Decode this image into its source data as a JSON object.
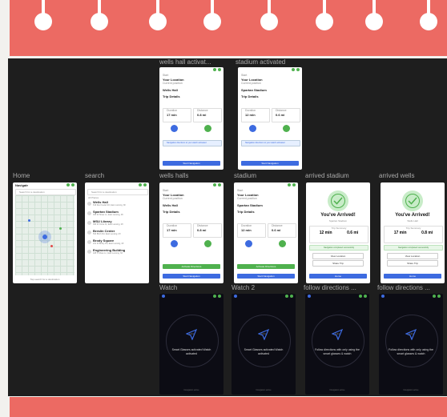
{
  "frames": {
    "wells_hall_activated": "wells hall activat...",
    "stadium_activated": "stadium activated",
    "home": "Home",
    "search": "search",
    "wells_halls": "wells halls",
    "stadium": "stadium",
    "arrived_stadium": "arrived stadium",
    "arrived_wells": "arrived wells",
    "watch": "Watch",
    "watch2": "Watch 2",
    "follow_directions_1": "follow directions ...",
    "follow_directions_2": "follow directions ..."
  },
  "home": {
    "title": "Navigatr",
    "search_placeholder": "Search for a destination",
    "hint": "Tap search for a destination"
  },
  "search": {
    "placeholder": "Search for a destination",
    "section": "All Places",
    "items": [
      {
        "name": "Wells Hall",
        "sub": "619 Red Cedar Rd, East Lansing, MI"
      },
      {
        "name": "Spartan Stadium",
        "sub": "325 W Shaw Ln, East Lansing, MI"
      },
      {
        "name": "MSU Library",
        "sub": "366 W Circle Dr, East Lansing, MI"
      },
      {
        "name": "Breslin Center",
        "sub": "534 Birch Rd, East Lansing, MI"
      },
      {
        "name": "Brody Square",
        "sub": "241 W Brody Rd, East Lansing, MI"
      },
      {
        "name": "Engineering Building",
        "sub": "428 S Shaw Ln, East Lansing, MI"
      }
    ]
  },
  "nav": {
    "your_location": "Your Location",
    "current_position": "Current position",
    "wells_hall": "Wells Hall",
    "spartan_stadium": "Spartan Stadium",
    "trip_details": "Trip Details",
    "duration_label": "Duration",
    "distance_label": "Distance",
    "wells_duration": "17 min",
    "wells_distance": "0.8 mi",
    "stadium_duration": "12 min",
    "stadium_distance": "0.6 mi",
    "walk": "Walk",
    "wheelchair": "Wheelchair",
    "activate": "Activate Directions",
    "start": "Start Navigation",
    "activated_note": "Navigation directions to your watch activated"
  },
  "arrived": {
    "title": "You've Arrived!",
    "stadium_name": "Spartan Stadium",
    "wells_name": "Wells Hall",
    "trip_summary": "Trip Summary",
    "stadium_time": "12 min",
    "stadium_dist": "0.6 mi",
    "wells_time": "17 min",
    "wells_dist": "0.8 mi",
    "completed": "Navigation completed successfully",
    "view_location": "View Location",
    "share_trip": "Share Trip",
    "home": "Home"
  },
  "watch": {
    "time": "9:41",
    "activated": "Smart Glasses activated Watch activated",
    "follow": "Follow directions with only using the smart glasses & watch",
    "footer": "Navigation active"
  },
  "colors": {
    "red": "#ec6a63",
    "green": "#4fb14e",
    "blue": "#3d6be0",
    "board": "#1e1e1e"
  }
}
